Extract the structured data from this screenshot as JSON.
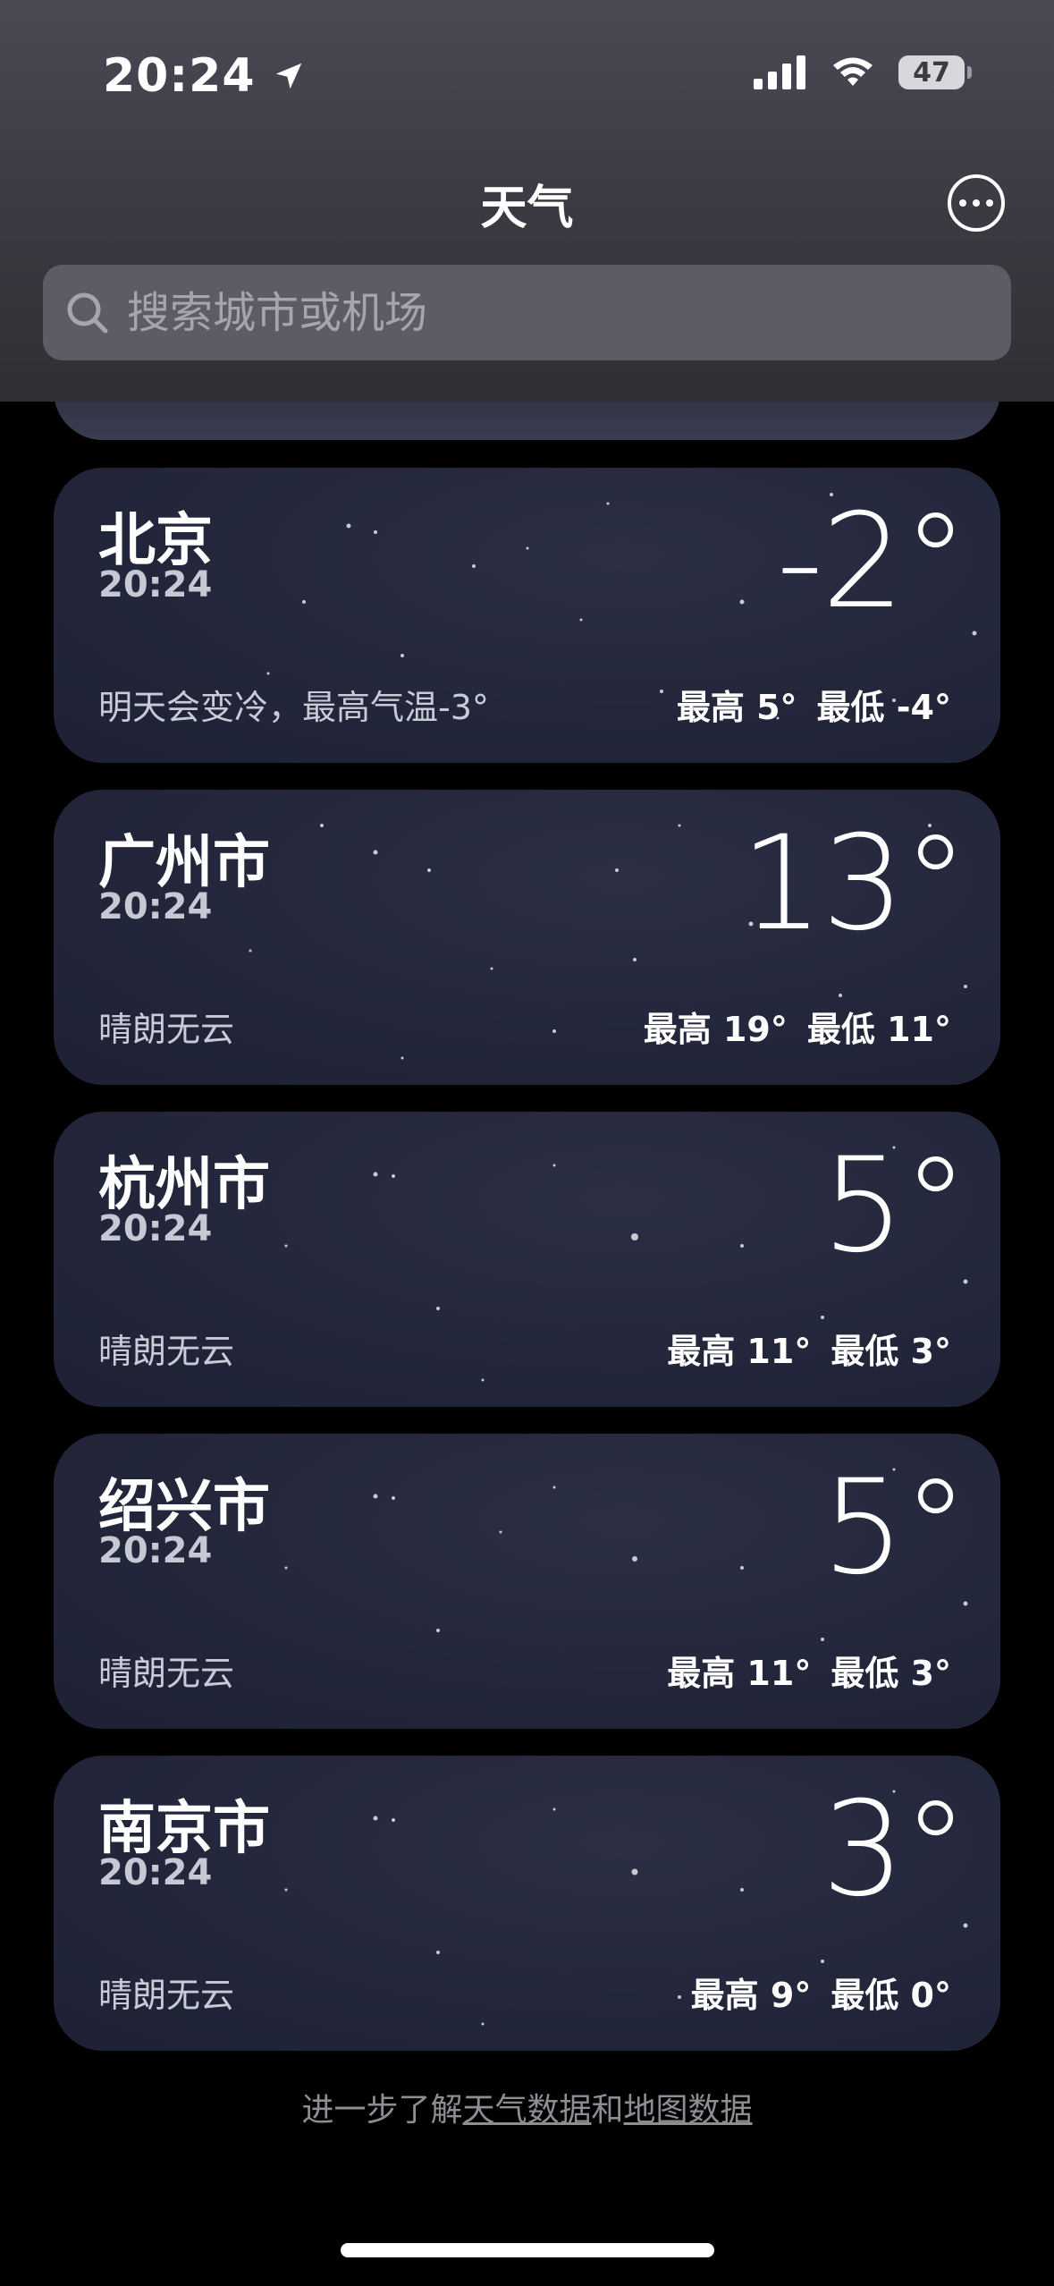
{
  "status": {
    "time": "20:24",
    "battery": "47"
  },
  "header": {
    "title": "天气",
    "search_placeholder": "搜索城市或机场"
  },
  "cards": [
    {
      "city": "北京",
      "time": "20:24",
      "temp": "-2°",
      "condition": "明天会变冷，最高气温-3°",
      "high": "最高 5°",
      "low": "最低 -4°"
    },
    {
      "city": "广州市",
      "time": "20:24",
      "temp": "13°",
      "condition": "晴朗无云",
      "high": "最高 19°",
      "low": "最低 11°"
    },
    {
      "city": "杭州市",
      "time": "20:24",
      "temp": "5°",
      "condition": "晴朗无云",
      "high": "最高 11°",
      "low": "最低 3°"
    },
    {
      "city": "绍兴市",
      "time": "20:24",
      "temp": "5°",
      "condition": "晴朗无云",
      "high": "最高 11°",
      "low": "最低 3°"
    },
    {
      "city": "南京市",
      "time": "20:24",
      "temp": "3°",
      "condition": "晴朗无云",
      "high": "最高 9°",
      "low": "最低 0°"
    }
  ],
  "footer": {
    "prefix": "进一步了解",
    "link1": "天气数据",
    "middle": "和",
    "link2": "地图数据"
  }
}
